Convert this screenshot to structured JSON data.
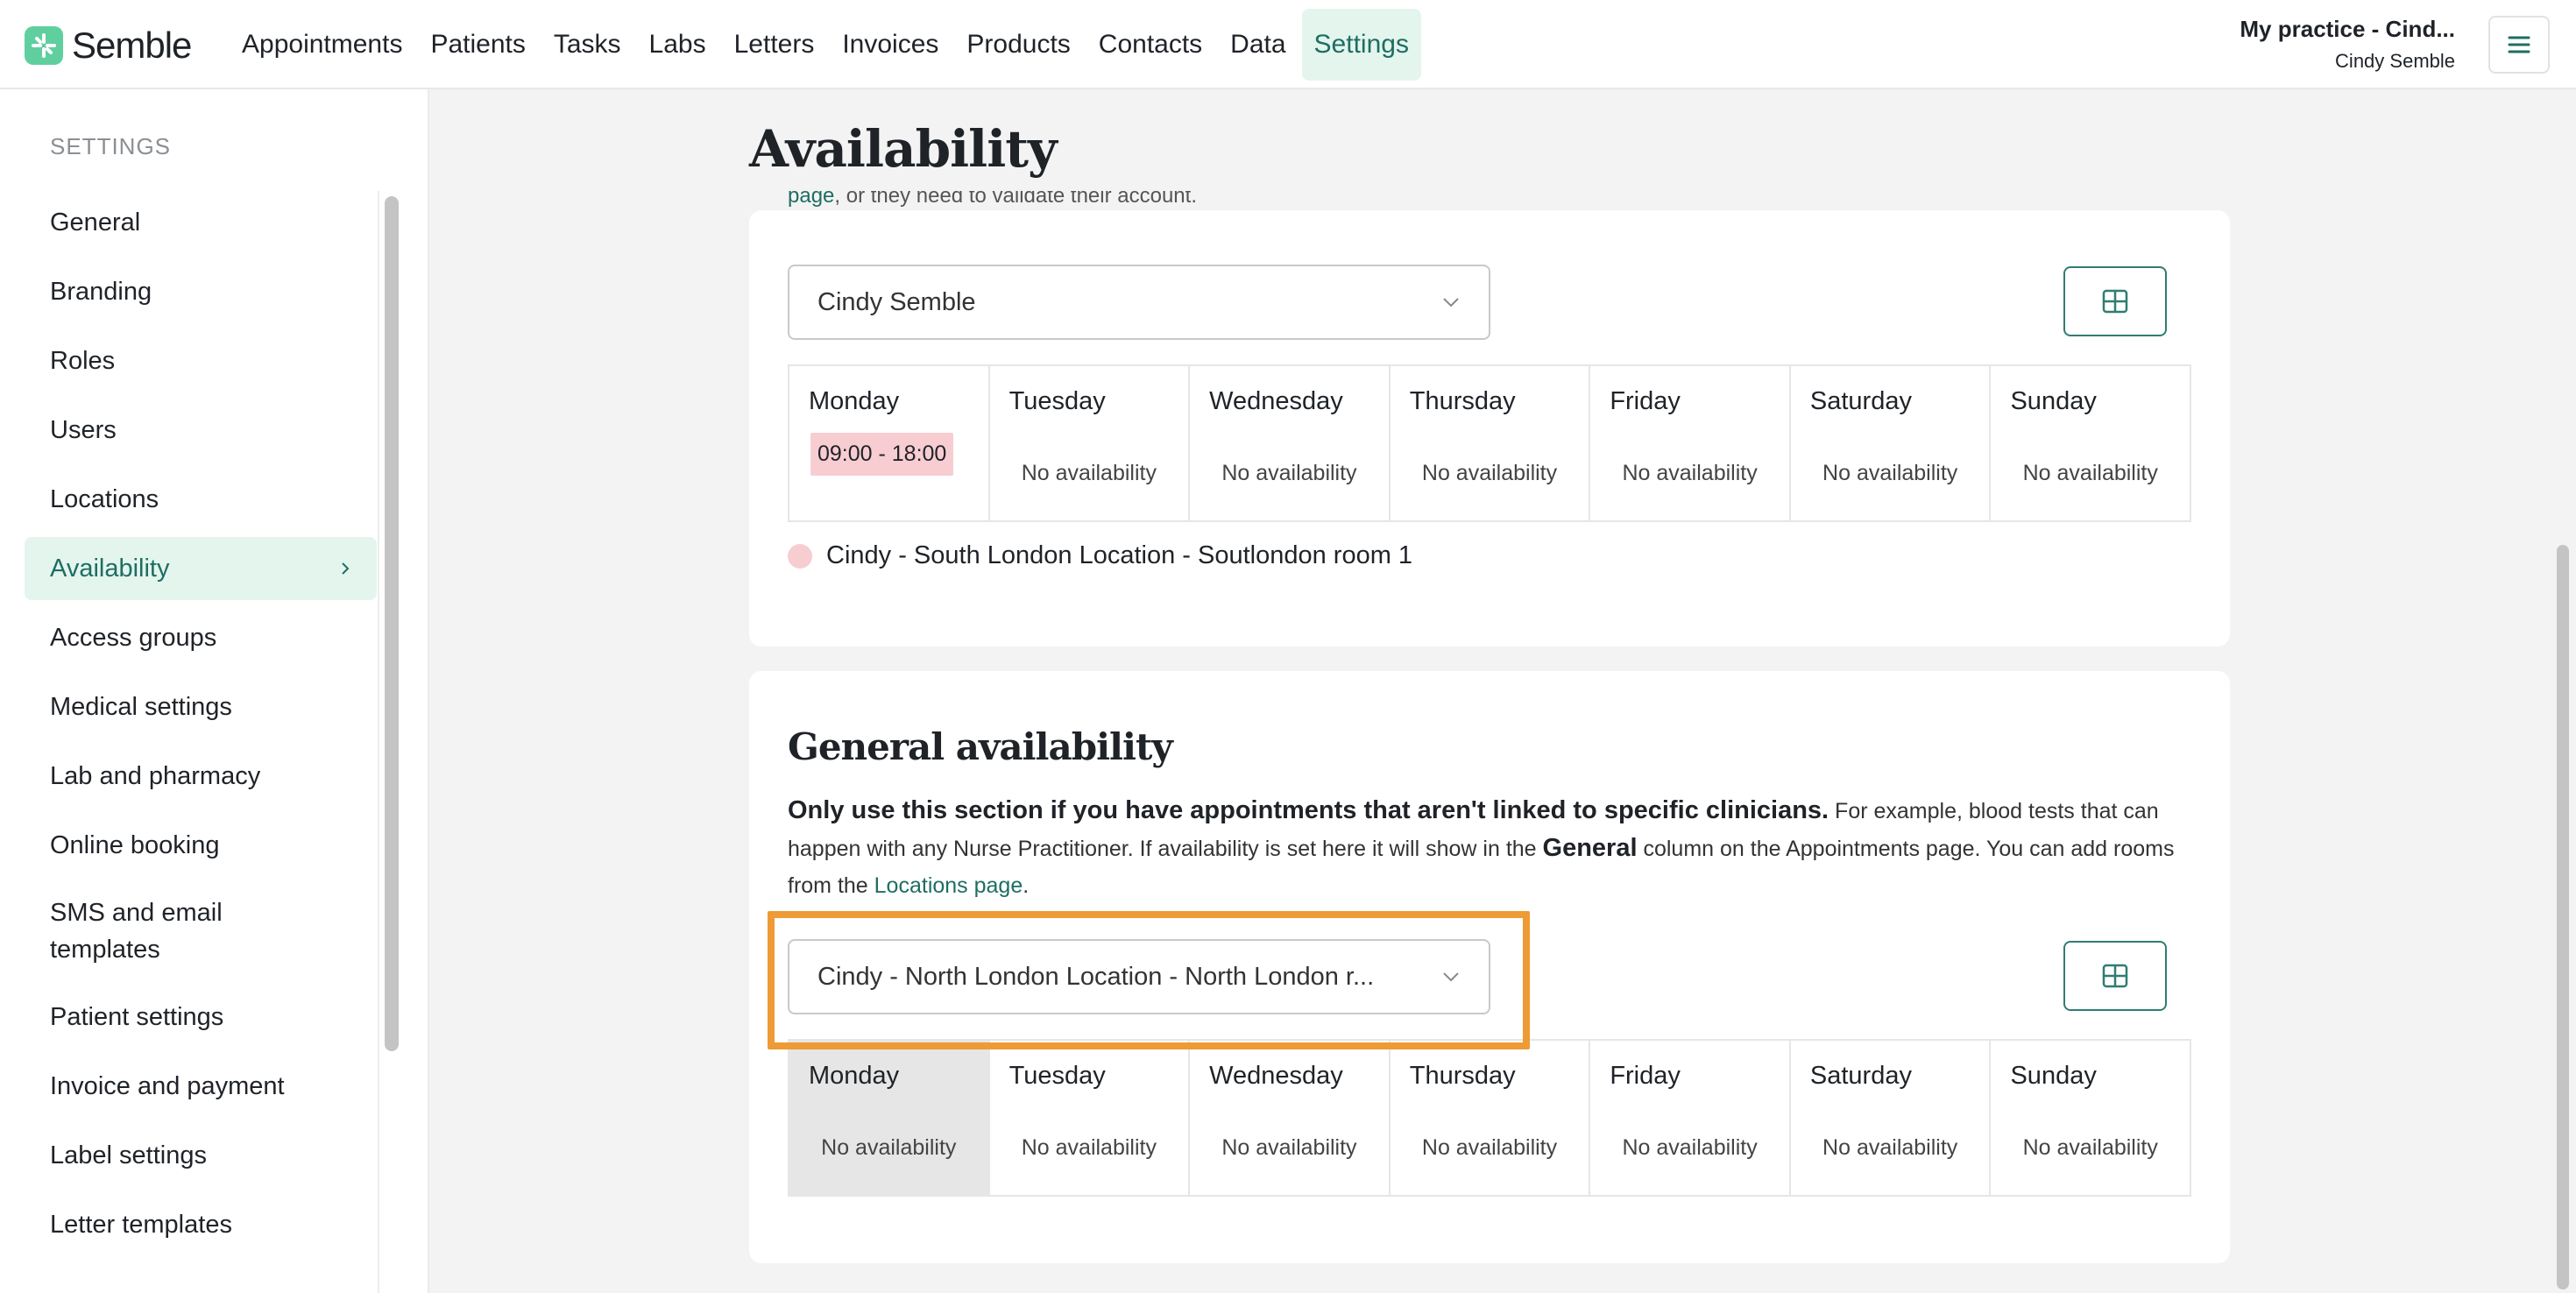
{
  "brand": {
    "name": "Semble",
    "color": "#5fcf9f",
    "accent": "#1e6e63"
  },
  "nav": {
    "items": [
      "Appointments",
      "Patients",
      "Tasks",
      "Labs",
      "Letters",
      "Invoices",
      "Products",
      "Contacts",
      "Data",
      "Settings"
    ],
    "active": "Settings"
  },
  "user": {
    "practice": "My practice - Cind...",
    "name": "Cindy Semble"
  },
  "sidebar": {
    "header": "SETTINGS",
    "items": [
      "General",
      "Branding",
      "Roles",
      "Users",
      "Locations",
      "Availability",
      "Access groups",
      "Medical settings",
      "Lab and pharmacy",
      "Online booking",
      "SMS and email templates",
      "Patient settings",
      "Invoice and payment",
      "Label settings",
      "Letter templates"
    ],
    "active": "Availability"
  },
  "page": {
    "title": "Availability"
  },
  "clinician_section": {
    "clipped_text_link": "page",
    "clipped_text": ", or they need to validate their account.",
    "select_value": "Cindy Semble",
    "days": [
      "Monday",
      "Tuesday",
      "Wednesday",
      "Thursday",
      "Friday",
      "Saturday",
      "Sunday"
    ],
    "values": [
      "09:00 - 18:00",
      "No availability",
      "No availability",
      "No availability",
      "No availability",
      "No availability",
      "No availability"
    ],
    "legend": "Cindy - South London Location - Soutlondon room 1",
    "slot_color": "#f7cdd2"
  },
  "general_section": {
    "title": "General availability",
    "desc_bold": "Only use this section if you have appointments that aren't linked to specific clinicians.",
    "desc_1": " For example, blood tests that can happen with any Nurse Practitioner. If availability is set here it will show in the ",
    "desc_bold_2": "General",
    "desc_2": " column on the Appointments page. You can add rooms from the ",
    "desc_link": "Locations page",
    "desc_end": ".",
    "select_value": "Cindy - North London Location - North London r...",
    "days": [
      "Monday",
      "Tuesday",
      "Wednesday",
      "Thursday",
      "Friday",
      "Saturday",
      "Sunday"
    ],
    "values": [
      "No availability",
      "No availability",
      "No availability",
      "No availability",
      "No availability",
      "No availability",
      "No availability"
    ],
    "highlight_color": "#ee9a35"
  }
}
